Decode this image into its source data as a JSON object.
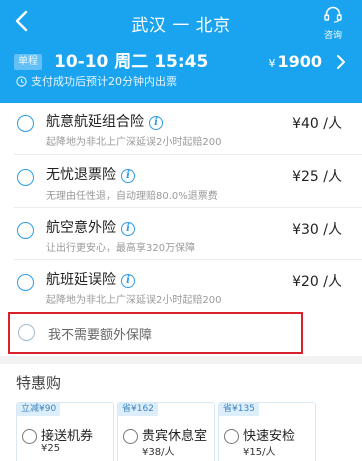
{
  "header": {
    "route": "武汉 一 北京",
    "consult_label": "咨询",
    "trip_badge": "单程",
    "date_time": "10-10 周二 15:45",
    "price_symbol": "¥",
    "price": "1900",
    "notice": "支付成功后预计20分钟内出票"
  },
  "insurance": [
    {
      "name": "航意航延组合险",
      "desc": "起降地为非北上广深延误2小时起赔200",
      "price": "¥40 /人"
    },
    {
      "name": "无忧退票险",
      "desc": "无理由任性退，自动理赔80.0%退票费",
      "price": "¥25 /人"
    },
    {
      "name": "航空意外险",
      "desc": "让出行更安心，最高享320万保障",
      "price": "¥30 /人"
    },
    {
      "name": "航班延误险",
      "desc": "起降地为非北上广深延误2小时起赔200",
      "price": "¥20 /人"
    }
  ],
  "no_insurance_label": "我不需要额外保障",
  "special": {
    "title": "特惠购",
    "deals": [
      {
        "badge": "立减¥90",
        "name": "接送机券",
        "price": "¥25"
      },
      {
        "badge": "省¥162",
        "name": "贵宾休息室",
        "price": "¥38/人"
      },
      {
        "badge": "省¥135",
        "name": "快速安检",
        "price": "¥15/人"
      }
    ]
  },
  "colors": {
    "header_bg": "#1aa3ee",
    "accent": "#2f9be5",
    "highlight_border": "#d9202b"
  }
}
